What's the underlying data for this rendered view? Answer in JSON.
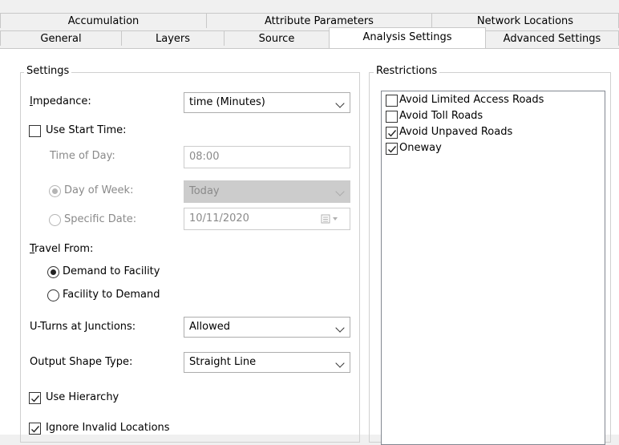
{
  "tabs_row1": [
    "Accumulation",
    "Attribute Parameters",
    "Network Locations"
  ],
  "tabs_row2": [
    "General",
    "Layers",
    "Source",
    "Analysis Settings",
    "Advanced Settings"
  ],
  "settings": {
    "legend": "Settings",
    "impedance_label": "Impedance:",
    "impedance_value": "time (Minutes)",
    "use_start_time": {
      "label": "Use Start Time:",
      "checked": false
    },
    "time_of_day_label": "Time of Day:",
    "time_of_day_value": "08:00",
    "day_of_week_label": "Day of Week:",
    "day_of_week_value": "Today",
    "specific_date_label": "Specific Date:",
    "specific_date_value": "10/11/2020",
    "travel_from_label": "Travel From:",
    "demand_to_facility": "Demand to Facility",
    "facility_to_demand": "Facility to Demand",
    "uturns_label": "U-Turns at Junctions:",
    "uturns_value": "Allowed",
    "output_shape_label": "Output Shape Type:",
    "output_shape_value": "Straight Line",
    "use_hierarchy": {
      "label": "Use Hierarchy",
      "checked": true
    },
    "ignore_invalid": {
      "label": "Ignore Invalid Locations",
      "checked": true
    }
  },
  "restrictions": {
    "legend": "Restrictions",
    "items": [
      {
        "label": "Avoid Limited Access Roads",
        "checked": false
      },
      {
        "label": "Avoid Toll Roads",
        "checked": false
      },
      {
        "label": "Avoid Unpaved Roads",
        "checked": true
      },
      {
        "label": "Oneway",
        "checked": true
      }
    ]
  }
}
